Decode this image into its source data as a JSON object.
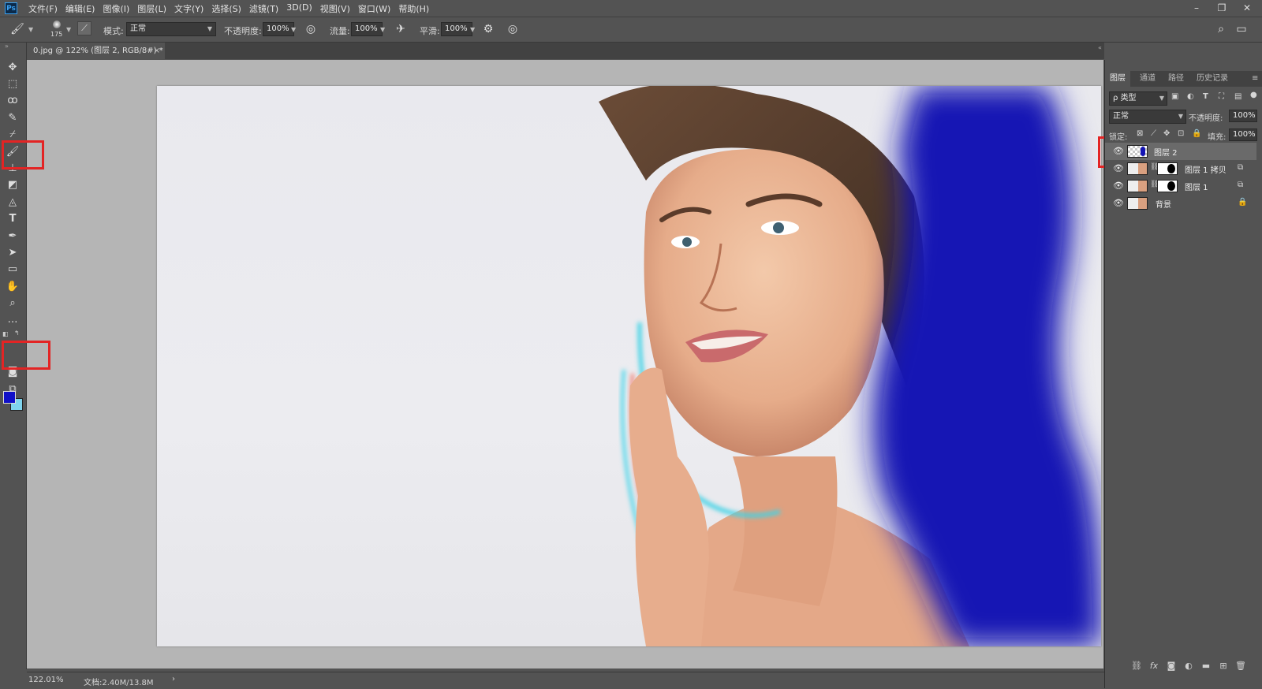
{
  "app": {
    "logo": "Ps"
  },
  "menu": [
    "文件(F)",
    "编辑(E)",
    "图像(I)",
    "图层(L)",
    "文字(Y)",
    "选择(S)",
    "滤镜(T)",
    "3D(D)",
    "视图(V)",
    "窗口(W)",
    "帮助(H)"
  ],
  "window_controls": {
    "minimize": "–",
    "restore": "❐",
    "close": "✕"
  },
  "options": {
    "brush_size": "175",
    "mode_label": "模式:",
    "mode_value": "正常",
    "opacity_label": "不透明度:",
    "opacity_value": "100%",
    "flow_label": "流量:",
    "flow_value": "100%",
    "smoothing_label": "平滑:",
    "smoothing_value": "100%"
  },
  "document": {
    "tab_title": "0.jpg @ 122% (图层 2, RGB/8#) *",
    "close": "×"
  },
  "status": {
    "zoom": "122.01%",
    "doc_size": "文档:2.40M/13.8M",
    "arrow": "›"
  },
  "colors": {
    "foreground": "#1010c8",
    "background": "#7fd4ee",
    "paint": "#1414b4",
    "highlight": "#e32424"
  },
  "layers_panel": {
    "tabs": [
      "图层",
      "通道",
      "路径",
      "历史记录"
    ],
    "filter_label": "ρ 类型",
    "blend_mode": "正常",
    "opacity_label": "不透明度:",
    "opacity_value": "100%",
    "lock_label": "锁定:",
    "fill_label": "填充:",
    "fill_value": "100%",
    "layers": [
      {
        "name": "图层 2",
        "selected": true
      },
      {
        "name": "图层 1 拷贝",
        "selected": false
      },
      {
        "name": "图层 1",
        "selected": false
      },
      {
        "name": "背景",
        "selected": false
      }
    ]
  }
}
